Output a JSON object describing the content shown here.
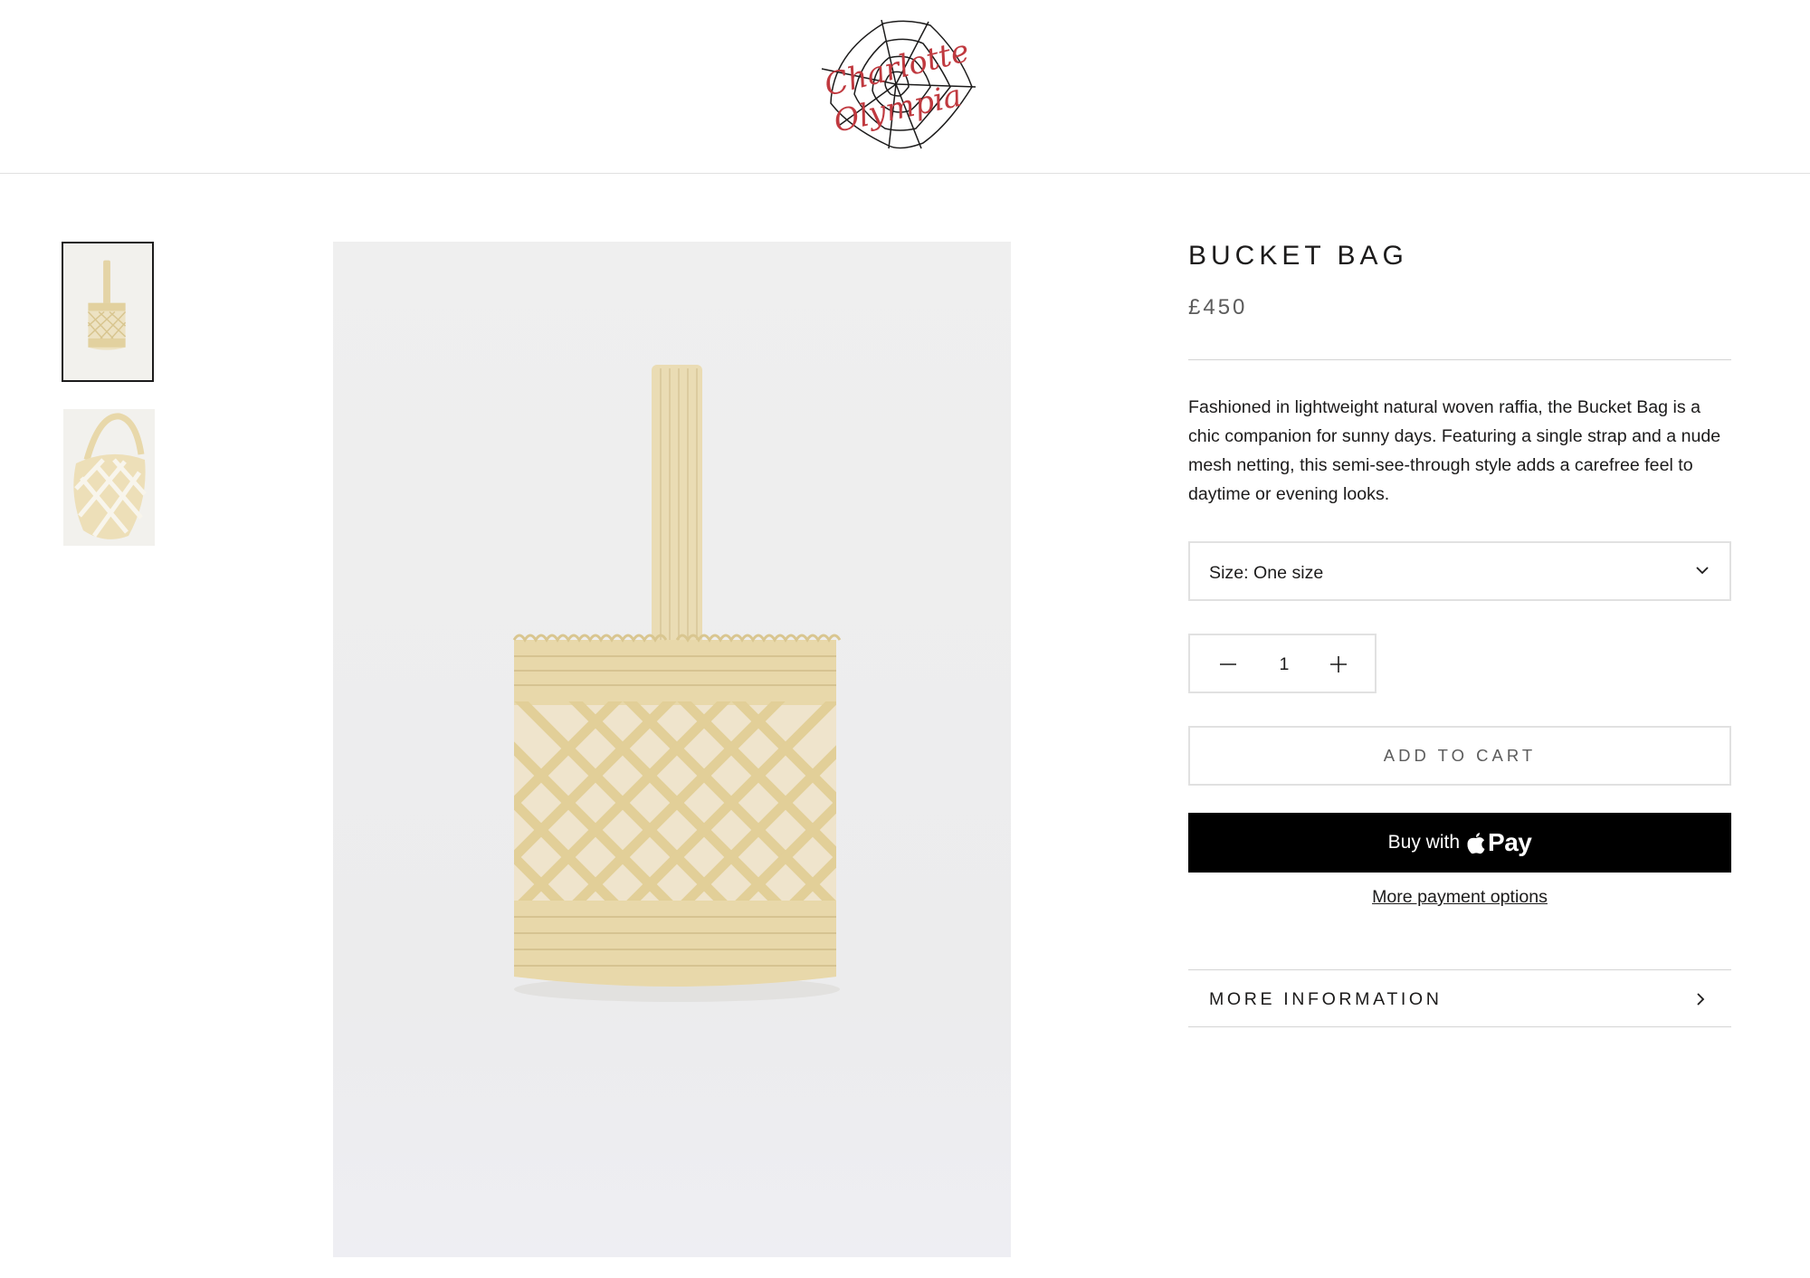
{
  "brand": {
    "logo_text_line1": "Charlotte",
    "logo_text_line2": "Olympia",
    "logo_color": "#c0393f"
  },
  "gallery": {
    "thumbnails": [
      {
        "name": "bucket-bag-front",
        "selected": true
      },
      {
        "name": "bucket-bag-angle",
        "selected": false
      }
    ],
    "main_image": "bucket-bag-front"
  },
  "product": {
    "title": "BUCKET BAG",
    "price": "£450",
    "description": "Fashioned in lightweight natural woven raffia, the Bucket Bag is a chic companion for sunny days. Featuring a single strap and a nude mesh netting, this semi-see-through style adds a carefree feel to daytime or evening looks."
  },
  "options": {
    "size_label": "Size: One size",
    "quantity": "1"
  },
  "actions": {
    "add_to_cart": "ADD TO CART",
    "buy_with": "Buy with",
    "pay_word": "Pay",
    "more_payment_options": "More payment options",
    "more_information": "MORE INFORMATION"
  },
  "icons": {
    "size_dropdown": "chevron-down-icon",
    "quantity_minus": "minus-icon",
    "quantity_plus": "plus-icon",
    "apple": "apple-logo-icon",
    "more_info": "chevron-right-icon"
  },
  "colors": {
    "text": "#1c1b1b",
    "muted": "#5c5c5c",
    "border": "#e1e1e1",
    "apple_pay_bg": "#000000",
    "raffia": "#e8d9ae"
  }
}
